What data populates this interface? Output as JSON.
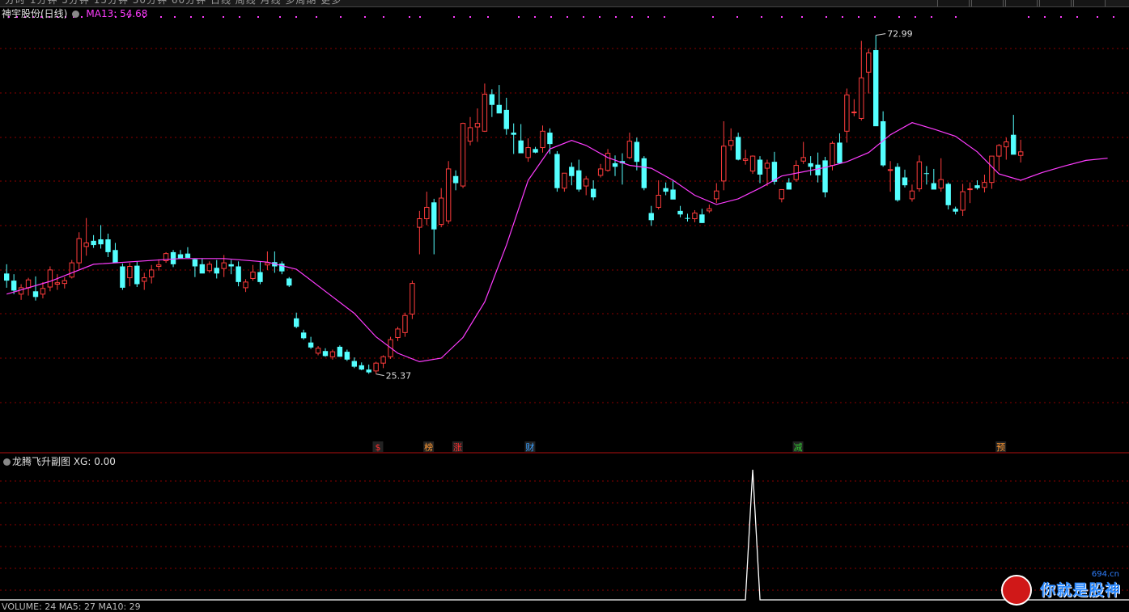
{
  "app": {
    "stock_title": "神宇股份(日线)",
    "ma_label": "MA13: 54.68",
    "sub_title": "龙腾飞升副图 XG: 0.00",
    "footer": "VOLUME: 24 MA5: 27 MA10: 29",
    "watermark_text": "你就是股神",
    "watermark_site": "694.cn"
  },
  "colors": {
    "background": "#000000",
    "up": "#ff3c3c",
    "down": "#54ffff",
    "ma": "#ff3cff",
    "grid": "#8b0000",
    "signal": "#ffffff"
  },
  "chart_data": [
    {
      "type": "candlestick",
      "title": "神宇股份(日线)",
      "indicator": "MA13",
      "ma_last": 54.68,
      "ylim": [
        22,
        78
      ],
      "high_label": "72.99",
      "low_label": "25.37",
      "candles": [
        [
          39.5,
          40.8,
          37.5,
          38.5
        ],
        [
          38.5,
          39.4,
          36.6,
          37.1
        ],
        [
          36.6,
          38.0,
          35.8,
          37.5
        ],
        [
          37.5,
          38.9,
          36.4,
          38.6
        ],
        [
          37.0,
          39.1,
          35.7,
          36.2
        ],
        [
          36.6,
          38.3,
          36.0,
          37.4
        ],
        [
          37.6,
          40.5,
          37.0,
          40.0
        ],
        [
          38.0,
          39.4,
          37.2,
          38.2
        ],
        [
          38.1,
          39.0,
          37.4,
          38.5
        ],
        [
          39.0,
          41.4,
          38.8,
          41.0
        ],
        [
          41.0,
          45.3,
          40.1,
          44.4
        ],
        [
          43.3,
          47.3,
          42.0,
          43.8
        ],
        [
          44.1,
          44.9,
          43.1,
          43.5
        ],
        [
          44.3,
          46.3,
          43.0,
          43.6
        ],
        [
          44.3,
          45.1,
          41.8,
          42.5
        ],
        [
          42.8,
          43.8,
          41.0,
          41.0
        ],
        [
          40.5,
          40.9,
          37.2,
          37.5
        ],
        [
          38.9,
          41.0,
          37.7,
          40.5
        ],
        [
          40.6,
          41.2,
          37.6,
          38.0
        ],
        [
          38.4,
          39.6,
          37.2,
          38.9
        ],
        [
          39.0,
          40.7,
          38.1,
          40.0
        ],
        [
          40.5,
          41.5,
          39.9,
          40.7
        ],
        [
          41.3,
          42.5,
          41.0,
          42.3
        ],
        [
          42.5,
          42.8,
          40.4,
          40.8
        ],
        [
          42.2,
          42.8,
          41.6,
          41.6
        ],
        [
          42.3,
          43.2,
          42.0,
          41.7
        ],
        [
          41.5,
          41.6,
          39.0,
          40.5
        ],
        [
          40.8,
          41.6,
          39.9,
          39.5
        ],
        [
          39.9,
          41.2,
          39.6,
          40.8
        ],
        [
          40.3,
          41.4,
          38.8,
          39.5
        ],
        [
          40.2,
          42.1,
          39.0,
          41.0
        ],
        [
          40.8,
          41.4,
          39.4,
          40.5
        ],
        [
          40.5,
          41.2,
          37.7,
          38.3
        ],
        [
          37.5,
          38.7,
          36.9,
          38.3
        ],
        [
          38.8,
          40.7,
          38.5,
          39.7
        ],
        [
          39.7,
          41.2,
          38.0,
          38.3
        ],
        [
          40.7,
          42.6,
          40.0,
          41.0
        ],
        [
          41.1,
          42.6,
          39.6,
          40.5
        ],
        [
          40.9,
          41.2,
          39.4,
          39.8
        ],
        [
          38.8,
          39.0,
          37.6,
          37.8
        ],
        [
          33.2,
          34.0,
          31.8,
          32.0
        ],
        [
          31.2,
          31.6,
          30.2,
          30.4
        ],
        [
          29.8,
          30.6,
          28.9,
          29.1
        ],
        [
          28.3,
          29.3,
          28.0,
          29.0
        ],
        [
          28.6,
          29.0,
          27.8,
          27.9
        ],
        [
          27.8,
          28.8,
          27.4,
          28.5
        ],
        [
          29.2,
          29.4,
          27.8,
          27.8
        ],
        [
          28.5,
          28.8,
          27.2,
          27.4
        ],
        [
          27.2,
          27.7,
          26.2,
          26.4
        ],
        [
          26.6,
          27.0,
          25.9,
          26.0
        ],
        [
          26.0,
          26.7,
          25.4,
          25.6
        ],
        [
          25.8,
          27.1,
          25.37,
          26.9
        ],
        [
          26.9,
          28.0,
          26.2,
          27.8
        ],
        [
          27.8,
          30.6,
          27.5,
          30.2
        ],
        [
          30.5,
          32.0,
          30.0,
          31.7
        ],
        [
          31.2,
          34.0,
          30.6,
          33.6
        ],
        [
          33.8,
          38.5,
          33.1,
          38.1
        ],
        [
          46.0,
          48.3,
          42.2,
          47.2
        ],
        [
          47.2,
          51.0,
          46.3,
          48.8
        ],
        [
          49.5,
          50.0,
          42.2,
          45.7
        ],
        [
          46.4,
          51.5,
          46.0,
          50.1
        ],
        [
          46.9,
          55.3,
          46.5,
          54.2
        ],
        [
          53.2,
          54.0,
          51.2,
          52.2
        ],
        [
          51.8,
          60.7,
          51.5,
          60.6
        ],
        [
          58.1,
          61.5,
          57.5,
          60.0
        ],
        [
          60.1,
          62.7,
          58.0,
          60.6
        ],
        [
          59.5,
          66.2,
          59.4,
          64.7
        ],
        [
          64.7,
          65.4,
          61.5,
          63.2
        ],
        [
          63.2,
          66.0,
          62.2,
          62.0
        ],
        [
          62.5,
          64.2,
          59.0,
          59.8
        ],
        [
          59.3,
          60.6,
          56.3,
          59.0
        ],
        [
          58.2,
          60.5,
          57.8,
          56.4
        ],
        [
          55.8,
          58.5,
          55.2,
          57.2
        ],
        [
          57.0,
          57.3,
          56.4,
          56.5
        ],
        [
          57.2,
          60.3,
          56.5,
          59.5
        ],
        [
          59.3,
          59.9,
          56.3,
          57.7
        ],
        [
          56.3,
          56.7,
          51.0,
          51.5
        ],
        [
          51.5,
          53.5,
          51.0,
          53.6
        ],
        [
          54.5,
          55.1,
          51.9,
          53.2
        ],
        [
          54.0,
          55.5,
          51.0,
          51.3
        ],
        [
          51.8,
          53.2,
          50.5,
          52.8
        ],
        [
          51.4,
          52.6,
          49.8,
          50.2
        ],
        [
          53.3,
          54.9,
          53.0,
          54.2
        ],
        [
          54.0,
          57.0,
          53.8,
          56.4
        ],
        [
          55.0,
          56.1,
          53.2,
          54.5
        ],
        [
          55.3,
          56.4,
          52.0,
          55.0
        ],
        [
          55.8,
          59.3,
          55.6,
          58.1
        ],
        [
          58.0,
          58.6,
          54.0,
          55.2
        ],
        [
          55.7,
          56.0,
          51.2,
          51.5
        ],
        [
          48.0,
          49.0,
          46.2,
          47.0
        ],
        [
          48.8,
          52.6,
          48.5,
          50.5
        ],
        [
          51.5,
          52.3,
          50.5,
          51.0
        ],
        [
          51.3,
          52.6,
          50.4,
          49.9
        ],
        [
          48.3,
          49.0,
          47.4,
          47.8
        ],
        [
          47.3,
          47.9,
          46.8,
          47.2
        ],
        [
          47.2,
          48.4,
          46.7,
          48.0
        ],
        [
          47.8,
          48.6,
          46.6,
          46.6
        ],
        [
          48.3,
          49.2,
          48.0,
          48.6
        ],
        [
          50.0,
          52.2,
          49.4,
          51.1
        ],
        [
          52.5,
          60.9,
          51.2,
          57.4
        ],
        [
          57.5,
          59.9,
          56.8,
          58.2
        ],
        [
          58.7,
          59.3,
          55.4,
          55.5
        ],
        [
          55.4,
          56.9,
          54.8,
          55.6
        ],
        [
          53.9,
          56.1,
          53.5,
          56.0
        ],
        [
          55.5,
          56.0,
          52.2,
          53.4
        ],
        [
          54.3,
          55.5,
          51.8,
          55.0
        ],
        [
          55.2,
          56.6,
          52.0,
          52.4
        ],
        [
          50.0,
          51.3,
          49.5,
          51.3
        ],
        [
          52.3,
          52.9,
          51.7,
          51.3
        ],
        [
          52.7,
          55.4,
          52.4,
          54.7
        ],
        [
          55.3,
          58.0,
          54.9,
          55.8
        ],
        [
          55.0,
          56.0,
          53.3,
          54.5
        ],
        [
          54.8,
          56.5,
          52.3,
          53.3
        ],
        [
          55.4,
          55.9,
          50.2,
          50.9
        ],
        [
          54.7,
          58.1,
          54.0,
          57.8
        ],
        [
          57.9,
          59.2,
          55.0,
          55.0
        ],
        [
          59.5,
          65.5,
          57.9,
          64.6
        ],
        [
          62.2,
          64.0,
          61.6,
          62.2
        ],
        [
          61.3,
          72.2,
          61.0,
          67.0
        ],
        [
          67.8,
          71.1,
          64.8,
          70.5
        ],
        [
          70.9,
          72.99,
          60.9,
          60.2
        ],
        [
          60.9,
          62.3,
          54.5,
          54.7
        ],
        [
          54.0,
          55.3,
          51.0,
          54.1
        ],
        [
          54.5,
          55.0,
          49.6,
          49.8
        ],
        [
          53.0,
          54.1,
          51.6,
          51.9
        ],
        [
          50.0,
          52.0,
          49.6,
          51.1
        ],
        [
          51.4,
          56.1,
          51.0,
          55.2
        ],
        [
          53.6,
          54.6,
          52.0,
          53.5
        ],
        [
          52.2,
          54.2,
          51.5,
          51.3
        ],
        [
          51.5,
          55.7,
          51.0,
          52.7
        ],
        [
          52.1,
          52.3,
          48.5,
          49.1
        ],
        [
          48.6,
          48.9,
          47.8,
          48.2
        ],
        [
          48.4,
          52.1,
          47.6,
          51.0
        ],
        [
          51.3,
          52.3,
          49.4,
          51.4
        ],
        [
          51.9,
          52.6,
          51.3,
          51.5
        ],
        [
          51.6,
          53.4,
          50.9,
          52.3
        ],
        [
          52.3,
          56.0,
          51.4,
          56.0
        ],
        [
          56.0,
          57.7,
          53.9,
          57.5
        ],
        [
          57.3,
          58.6,
          55.5,
          58.0
        ],
        [
          59.0,
          61.8,
          56.3,
          56.2
        ],
        [
          56.1,
          58.3,
          55.1,
          56.6
        ]
      ],
      "ma13": [
        [
          0,
          36.6
        ],
        [
          6,
          38.4
        ],
        [
          12,
          40.8
        ],
        [
          18,
          41.2
        ],
        [
          24,
          41.6
        ],
        [
          30,
          41.6
        ],
        [
          36,
          41.1
        ],
        [
          40,
          40.1
        ],
        [
          44,
          37.0
        ],
        [
          48,
          33.9
        ],
        [
          51,
          30.6
        ],
        [
          54,
          28.3
        ],
        [
          57,
          27.1
        ],
        [
          60,
          27.6
        ],
        [
          63,
          30.5
        ],
        [
          66,
          35.5
        ],
        [
          69,
          43.5
        ],
        [
          72,
          52.6
        ],
        [
          75,
          57.0
        ],
        [
          78,
          58.2
        ],
        [
          80,
          57.5
        ],
        [
          83,
          55.8
        ],
        [
          86,
          54.7
        ],
        [
          89,
          54.3
        ],
        [
          92,
          52.6
        ],
        [
          95,
          50.5
        ],
        [
          98,
          49.2
        ],
        [
          101,
          50.0
        ],
        [
          104,
          51.5
        ],
        [
          107,
          53.2
        ],
        [
          110,
          53.8
        ],
        [
          113,
          54.4
        ],
        [
          116,
          55.2
        ],
        [
          119,
          56.5
        ],
        [
          122,
          59.0
        ],
        [
          125,
          60.7
        ],
        [
          128,
          59.8
        ],
        [
          131,
          58.8
        ],
        [
          134,
          56.6
        ],
        [
          137,
          53.5
        ],
        [
          140,
          52.6
        ],
        [
          143,
          53.7
        ],
        [
          146,
          54.6
        ],
        [
          149,
          55.4
        ],
        [
          152,
          55.7
        ]
      ],
      "markers": [
        {
          "index": 51,
          "label": "$",
          "color": "#ff3030"
        },
        {
          "index": 58,
          "label": "榜",
          "color": "#ff9933"
        },
        {
          "index": 62,
          "label": "涨",
          "color": "#ff3030"
        },
        {
          "index": 72,
          "label": "财",
          "color": "#3aa0ff"
        },
        {
          "index": 109,
          "label": "减",
          "color": "#33cc33"
        },
        {
          "index": 137,
          "label": "预",
          "color": "#ff9933"
        }
      ]
    },
    {
      "type": "line",
      "title": "龙腾飞升副图",
      "series": [
        {
          "name": "XG",
          "last": 0.0,
          "spike_index": 103,
          "spike_value": 1
        }
      ]
    }
  ]
}
